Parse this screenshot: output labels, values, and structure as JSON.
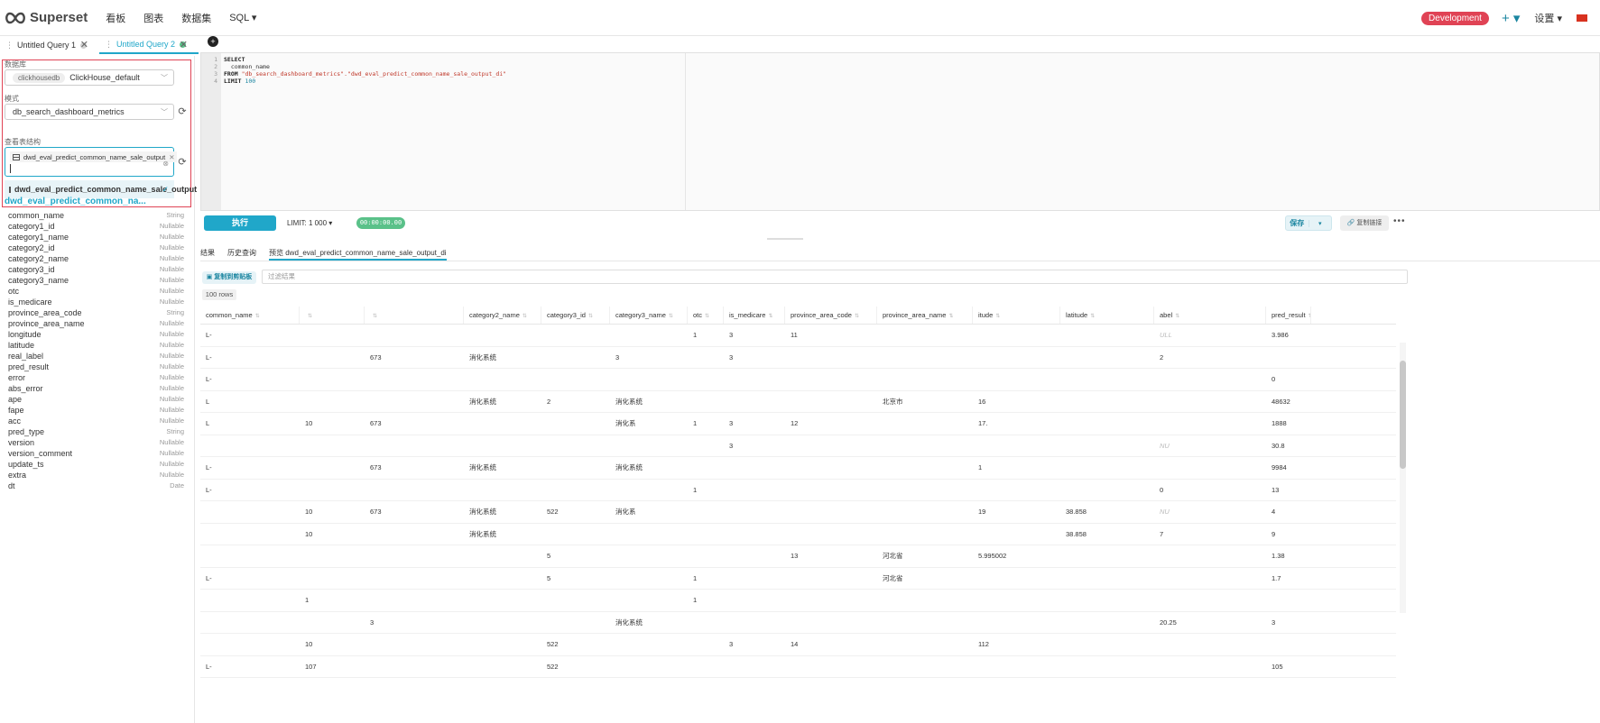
{
  "navbar": {
    "brand": "Superset",
    "menu": [
      "看板",
      "图表",
      "数据集",
      "SQL ▾"
    ],
    "env_badge": "Development",
    "plus": "+ ▾",
    "settings": "设置 ▾"
  },
  "query_tabs": [
    {
      "label": "Untitled Query 1",
      "status_color": "#d0d0d0"
    },
    {
      "label": "Untitled Query 2",
      "status_color": "#5ac189"
    }
  ],
  "left": {
    "database_label": "数据库",
    "database_tag": "clickhousedb",
    "database_value": "ClickHouse_default",
    "schema_label": "模式",
    "schema_value": "db_search_dashboard_metrics",
    "table_label": "查看表结构",
    "selected_table": "dwd_eval_predict_common_name_sale_output",
    "dropdown_option": "dwd_eval_predict_common_name_sale_output",
    "table_heading": "dwd_eval_predict_common_na...",
    "columns": [
      {
        "name": "common_name",
        "type": "String"
      },
      {
        "name": "category1_id",
        "type": "Nullable"
      },
      {
        "name": "category1_name",
        "type": "Nullable"
      },
      {
        "name": "category2_id",
        "type": "Nullable"
      },
      {
        "name": "category2_name",
        "type": "Nullable"
      },
      {
        "name": "category3_id",
        "type": "Nullable"
      },
      {
        "name": "category3_name",
        "type": "Nullable"
      },
      {
        "name": "otc",
        "type": "Nullable"
      },
      {
        "name": "is_medicare",
        "type": "Nullable"
      },
      {
        "name": "province_area_code",
        "type": "String"
      },
      {
        "name": "province_area_name",
        "type": "Nullable"
      },
      {
        "name": "longitude",
        "type": "Nullable"
      },
      {
        "name": "latitude",
        "type": "Nullable"
      },
      {
        "name": "real_label",
        "type": "Nullable"
      },
      {
        "name": "pred_result",
        "type": "Nullable"
      },
      {
        "name": "error",
        "type": "Nullable"
      },
      {
        "name": "abs_error",
        "type": "Nullable"
      },
      {
        "name": "ape",
        "type": "Nullable"
      },
      {
        "name": "fape",
        "type": "Nullable"
      },
      {
        "name": "acc",
        "type": "Nullable"
      },
      {
        "name": "pred_type",
        "type": "String"
      },
      {
        "name": "version",
        "type": "Nullable"
      },
      {
        "name": "version_comment",
        "type": "Nullable"
      },
      {
        "name": "update_ts",
        "type": "Nullable"
      },
      {
        "name": "extra",
        "type": "Nullable"
      },
      {
        "name": "dt",
        "type": "Date"
      }
    ]
  },
  "editor": {
    "line_numbers": [
      "1",
      "2",
      "3",
      "4"
    ],
    "line1": "SELECT",
    "line2": "  common_name",
    "line3_kw": "FROM ",
    "line3_str": "\"db_search_dashboard_metrics\".\"dwd_eval_predict_common_name_sale_output_di\"",
    "line4_kw": "LIMIT ",
    "line4_num": "100"
  },
  "toolbar": {
    "run": "执行",
    "limit": "LIMIT: 1 000  ▾",
    "timer": "00:00:00.00",
    "save": "保存",
    "save_dd": "▾",
    "share": "复制链接",
    "more": "•••"
  },
  "results": {
    "tabs": [
      "结果",
      "历史查询",
      "预览 dwd_eval_predict_common_name_sale_output_di"
    ],
    "copy": "复制到剪贴板",
    "filter_placeholder": "过滤结果",
    "row_count": "100 rows",
    "headers": [
      "common_name",
      "",
      "",
      "category2_name",
      "category3_id",
      "category3_name",
      "otc",
      "is_medicare",
      "province_area_code",
      "province_area_name",
      "itude",
      "latitude",
      "abel",
      "pred_result"
    ],
    "rows": [
      [
        "L-",
        "",
        "",
        "",
        "",
        "",
        "1",
        "3",
        "11",
        "",
        "",
        "",
        "ULL",
        "3.986"
      ],
      [
        "L-",
        "",
        "673",
        "消化系统",
        "",
        "3",
        "",
        "3",
        "",
        "",
        "",
        "",
        "2",
        ""
      ],
      [
        "L-",
        "",
        "",
        "",
        "",
        "",
        "",
        "",
        "",
        "",
        "",
        "",
        "",
        "0"
      ],
      [
        "L",
        "",
        "",
        "消化系统",
        "2",
        "消化系统",
        "",
        "",
        "",
        "北京市",
        "16",
        "",
        "",
        "48632"
      ],
      [
        "L",
        "10",
        "673",
        "",
        "",
        "消化系",
        "1",
        "3",
        "12",
        "",
        "17.",
        "",
        "",
        "1888"
      ],
      [
        "",
        "",
        "",
        "",
        "",
        "",
        "",
        "3",
        "",
        "",
        "",
        "",
        "NU",
        "30.8"
      ],
      [
        "L-",
        "",
        "673",
        "消化系统",
        "",
        "消化系统",
        "",
        "",
        "",
        "",
        "1",
        "",
        "",
        "9984"
      ],
      [
        "L-",
        "",
        "",
        "",
        "",
        "",
        "1",
        "",
        "",
        "",
        "",
        "",
        "0",
        "13"
      ],
      [
        "",
        "10",
        "673",
        "消化系统",
        "522",
        "消化系",
        "",
        "",
        "",
        "",
        "19",
        "38.858",
        "NU",
        "4"
      ],
      [
        "",
        "10",
        "",
        "消化系统",
        "",
        "",
        "",
        "",
        "",
        "",
        "",
        "38.858",
        "7",
        "9"
      ],
      [
        "",
        "",
        "",
        "",
        "5",
        "",
        "",
        "",
        "13",
        "河北省",
        "5.995002",
        "",
        "",
        "1.38"
      ],
      [
        "L-",
        "",
        "",
        "",
        "5",
        "",
        "1",
        "",
        "",
        "河北省",
        "",
        "",
        "",
        "1.7"
      ],
      [
        "",
        "1",
        "",
        "",
        "",
        "",
        "1",
        "",
        "",
        "",
        "",
        "",
        "",
        ""
      ],
      [
        "",
        "",
        "3",
        "",
        "",
        "消化系统",
        "",
        "",
        "",
        "",
        "",
        "",
        "20.25",
        "3"
      ],
      [
        "",
        "10",
        "",
        "",
        "522",
        "",
        "",
        "3",
        "14",
        "",
        "112",
        "",
        "",
        ""
      ],
      [
        "L-",
        "107",
        "",
        "",
        "522",
        "",
        "",
        "",
        "",
        "",
        "",
        "",
        "",
        "105"
      ]
    ]
  },
  "colors": {
    "accent": "#20a7c9",
    "env_badge": "#e04355",
    "timer": "#5ac189"
  }
}
